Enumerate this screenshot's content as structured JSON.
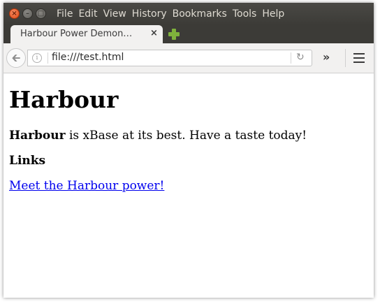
{
  "menu": [
    "File",
    "Edit",
    "View",
    "History",
    "Bookmarks",
    "Tools",
    "Help"
  ],
  "tab": {
    "title": "Harbour Power Demon…",
    "close_icon": "×"
  },
  "nav": {
    "url": "file:///test.html",
    "overflow_icon": "»"
  },
  "icons": {
    "window_close": "close-icon",
    "window_minimize": "minimize-icon",
    "window_maximize": "maximize-icon",
    "new_tab": "plus-icon",
    "back": "arrow-left-icon",
    "info": "info-icon",
    "reload": "reload-icon",
    "menu": "hamburger-icon"
  },
  "colors": {
    "close_button": "#df4a16",
    "new_tab": "#7fb13c",
    "link": "#0000ee"
  },
  "page": {
    "heading": "Harbour",
    "para_bold": "Harbour",
    "para_rest": " is xBase at its best. Have a taste today!",
    "subheading": "Links",
    "link": "Meet the Harbour power!"
  }
}
